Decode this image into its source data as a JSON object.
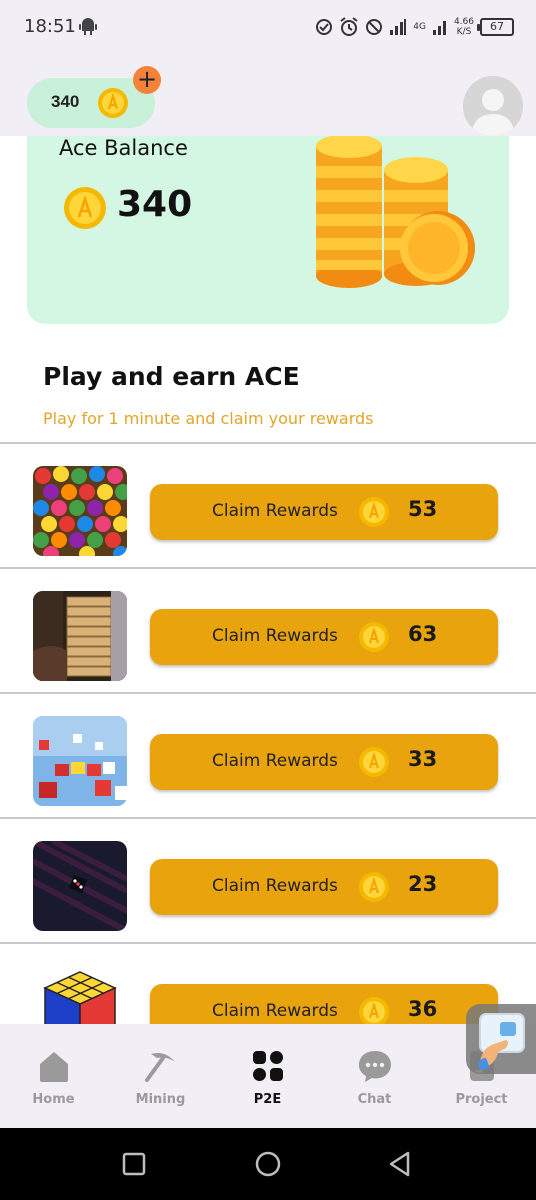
{
  "status_bar": {
    "time": "18:51",
    "network_speed_value": "4.66",
    "network_speed_unit": "K/S",
    "network_type": "4G",
    "battery": "67"
  },
  "header": {
    "balance_value": "340",
    "add_symbol": "+"
  },
  "balance_card": {
    "title": "Ace Balance",
    "value": "340"
  },
  "section": {
    "title": "Play and earn ACE",
    "subtitle": "Play for 1 minute and claim your rewards"
  },
  "games": [
    {
      "claim_label": "Claim Rewards",
      "amount": "53",
      "thumb": "colorful-balls"
    },
    {
      "claim_label": "Claim Rewards",
      "amount": "63",
      "thumb": "jenga-tower"
    },
    {
      "claim_label": "Claim Rewards",
      "amount": "33",
      "thumb": "letter-cubes"
    },
    {
      "claim_label": "Claim Rewards",
      "amount": "23",
      "thumb": "dark-dice"
    },
    {
      "claim_label": "Claim Rewards",
      "amount": "36",
      "thumb": "rubiks-cube"
    }
  ],
  "bottom_nav": {
    "items": [
      {
        "label": "Home",
        "icon": "home-icon",
        "active": false
      },
      {
        "label": "Mining",
        "icon": "pickaxe-icon",
        "active": false
      },
      {
        "label": "P2E",
        "icon": "grid-icon",
        "active": true
      },
      {
        "label": "Chat",
        "icon": "chat-bubble-icon",
        "active": false
      },
      {
        "label": "Project",
        "icon": "document-icon",
        "active": false
      }
    ]
  },
  "colors": {
    "accent": "#e9a30c",
    "card_bg": "#d3f7e2",
    "pill_bg": "#c9f1d9",
    "subtitle": "#e2a52a",
    "add_badge": "#f5823a"
  }
}
